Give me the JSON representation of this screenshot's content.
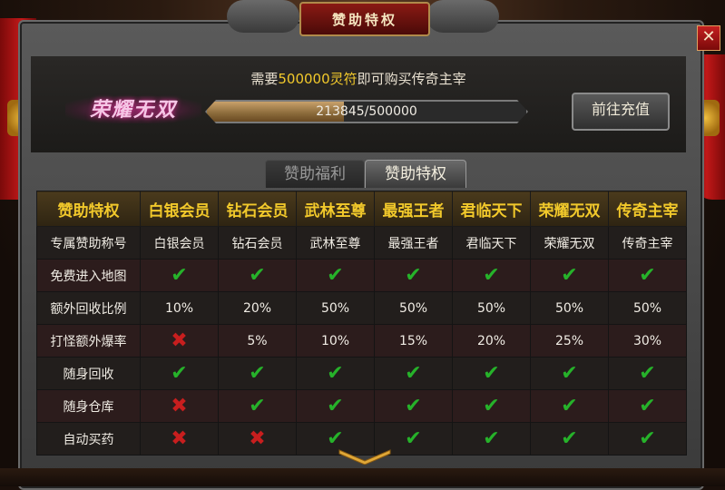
{
  "window": {
    "title": "赞助特权",
    "close_label": "✕"
  },
  "header": {
    "requirement_prefix": "需要",
    "requirement_amount": "500000灵符",
    "requirement_suffix": "即可购买传奇主宰",
    "rank_title": "荣耀无双",
    "progress_text": "213845/500000",
    "progress_fraction": 0.4277,
    "recharge_button": "前往充值"
  },
  "tabs": [
    {
      "label": "赞助福利",
      "active": false
    },
    {
      "label": "赞助特权",
      "active": true
    }
  ],
  "table": {
    "headers": [
      "赞助特权",
      "白银会员",
      "钻石会员",
      "武林至尊",
      "最强王者",
      "君临天下",
      "荣耀无双",
      "传奇主宰"
    ],
    "rows": [
      {
        "label": "专属赞助称号",
        "cells": [
          "白银会员",
          "钻石会员",
          "武林至尊",
          "最强王者",
          "君临天下",
          "荣耀无双",
          "传奇主宰"
        ]
      },
      {
        "label": "免费进入地图",
        "cells": [
          "check",
          "check",
          "check",
          "check",
          "check",
          "check",
          "check"
        ]
      },
      {
        "label": "额外回收比例",
        "cells": [
          "10%",
          "20%",
          "50%",
          "50%",
          "50%",
          "50%",
          "50%"
        ]
      },
      {
        "label": "打怪额外爆率",
        "cells": [
          "cross",
          "5%",
          "10%",
          "15%",
          "20%",
          "25%",
          "30%"
        ]
      },
      {
        "label": "随身回收",
        "cells": [
          "check",
          "check",
          "check",
          "check",
          "check",
          "check",
          "check"
        ]
      },
      {
        "label": "随身仓库",
        "cells": [
          "cross",
          "check",
          "check",
          "check",
          "check",
          "check",
          "check"
        ]
      },
      {
        "label": "自动买药",
        "cells": [
          "cross",
          "cross",
          "check",
          "check",
          "check",
          "check",
          "check"
        ]
      }
    ]
  },
  "colors": {
    "accent_gold": "#f2c92b",
    "check_green": "#26b22a",
    "cross_red": "#c81e1e"
  },
  "icons": {
    "check": "checkmark-icon",
    "cross": "cross-icon",
    "scroll": "chevron-down-icon"
  }
}
